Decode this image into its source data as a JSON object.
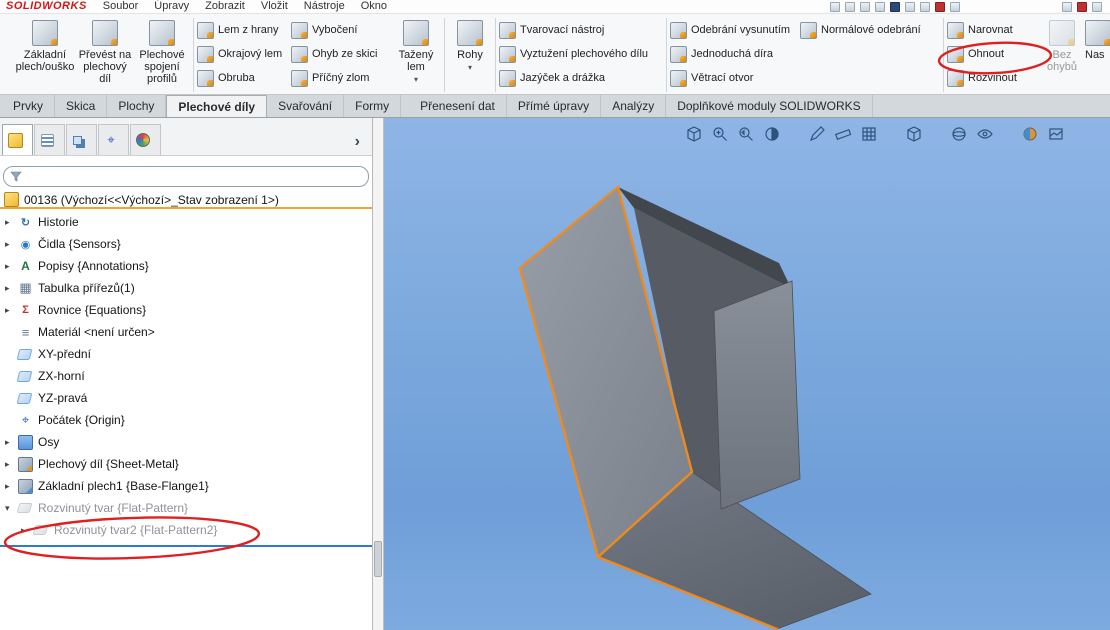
{
  "colors": {
    "viewport_top": "#8fb5e5",
    "viewport_bottom": "#7dabe0",
    "highlight_edge": "#ef8a1f",
    "annotation_red": "#e02020",
    "drop_indicator_blue": "#2f7ad0",
    "root_underline_orange": "#f0a438",
    "part_icon_yellow": "#edb93a"
  },
  "icons": {
    "expand-arrow": "▸",
    "collapse-arrow": "▾",
    "panel-chevron": "›",
    "history": "↻",
    "sensors": "◉",
    "annotations": "A",
    "cutlist": "▦",
    "equations": "Σ",
    "material": "≡",
    "origin": "⌖"
  },
  "menubar": {
    "logo": "SOLIDWORKS",
    "items": [
      "Soubor",
      "Úpravy",
      "Zobrazit",
      "Vložit",
      "Nástroje",
      "Okno"
    ]
  },
  "ribbon": {
    "base_flange": "Základní plech/ouško",
    "convert": "Převést na plechový díl",
    "lofted": "Plechové spojení profilů",
    "edge_flange": "Lem z hrany",
    "miter_flange": "Okrajový lem",
    "hem": "Obruba",
    "jog": "Vybočení",
    "sketched_bend": "Ohyb ze skici",
    "cross_break": "Příčný zlom",
    "swept_flange": "Tažený lem",
    "corners": "Rohy",
    "forming_tool": "Tvarovací nástroj",
    "gusset": "Vyztužení plechového dílu",
    "tab_slot": "Jazýček a drážka",
    "extruded_cut": "Odebrání vysunutím",
    "simple_hole": "Jednoduchá díra",
    "vent": "Větrací otvor",
    "normal_cut": "Normálové odebrání",
    "unfold": "Narovnat",
    "fold": "Ohnout",
    "flatten": "Rozvinout",
    "no_bends": "Bez ohybů",
    "cut_label": "Nas"
  },
  "tabs": [
    "Prvky",
    "Skica",
    "Plochy",
    "Plechové díly",
    "Svařování",
    "Formy",
    "Přenesení dat",
    "Přímé úpravy",
    "Analýzy",
    "Doplňkové moduly SOLIDWORKS"
  ],
  "tree": {
    "root": "00136 (Výchozí<<Výchozí>_Stav zobrazení 1>)",
    "filter_value": "",
    "items": [
      {
        "label": "Historie"
      },
      {
        "label": "Čidla {Sensors}"
      },
      {
        "label": "Popisy {Annotations}"
      },
      {
        "label": "Tabulka přířezů(1)"
      },
      {
        "label": "Rovnice {Equations}"
      },
      {
        "label": "Materiál <není určen>"
      },
      {
        "label": "XY-přední"
      },
      {
        "label": "ZX-horní"
      },
      {
        "label": "YZ-pravá"
      },
      {
        "label": "Počátek {Origin}"
      },
      {
        "label": "Osy"
      },
      {
        "label": "Plechový díl {Sheet-Metal}"
      },
      {
        "label": "Základní plech1 {Base-Flange1}"
      },
      {
        "label": "Rozvinutý tvar {Flat-Pattern}"
      },
      {
        "label": "Rozvinutý tvar2 {Flat-Pattern2}"
      }
    ]
  }
}
